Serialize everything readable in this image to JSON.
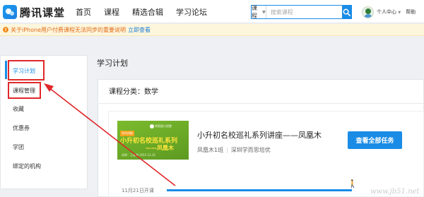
{
  "header": {
    "logo_text": "腾讯课堂",
    "nav": [
      "首页",
      "课程",
      "精选合辑",
      "学习论坛"
    ],
    "search": {
      "category": "课程",
      "placeholder": "搜索课程"
    },
    "user_center": "个人中心",
    "help": "帮助"
  },
  "notice": {
    "text": "关于iPhone用户付费课程无法同步的重要说明",
    "link": "立即查看"
  },
  "sidebar": {
    "items": [
      {
        "label": "学习计划"
      },
      {
        "label": "课程管理"
      },
      {
        "label": "收藏"
      },
      {
        "label": "优惠券"
      },
      {
        "label": "学团"
      },
      {
        "label": "绑定的机构"
      }
    ]
  },
  "main": {
    "title": "学习计划",
    "category": "课程分类：数学",
    "course": {
      "thumb": {
        "badge": "学而思小初堂",
        "label": "系列讲座",
        "title_line1": "小升初名校巡礼系列",
        "title_line2": "——凤凰木",
        "subtitle": "讲师：王老师  2015.11.21"
      },
      "title": "小升初名校巡礼系列讲座——凤凰木",
      "class_name": "凤凰木1班",
      "org": "深圳学而思培优",
      "button": "查看全部任务",
      "start_date": "11月21日开课"
    }
  },
  "watermark": "www.jb51.net",
  "colors": {
    "brand_blue": "#1a8ce6",
    "annotation_red": "#e0282a",
    "notice_orange": "#e26b16",
    "thumb_green": "#6aa82a"
  }
}
